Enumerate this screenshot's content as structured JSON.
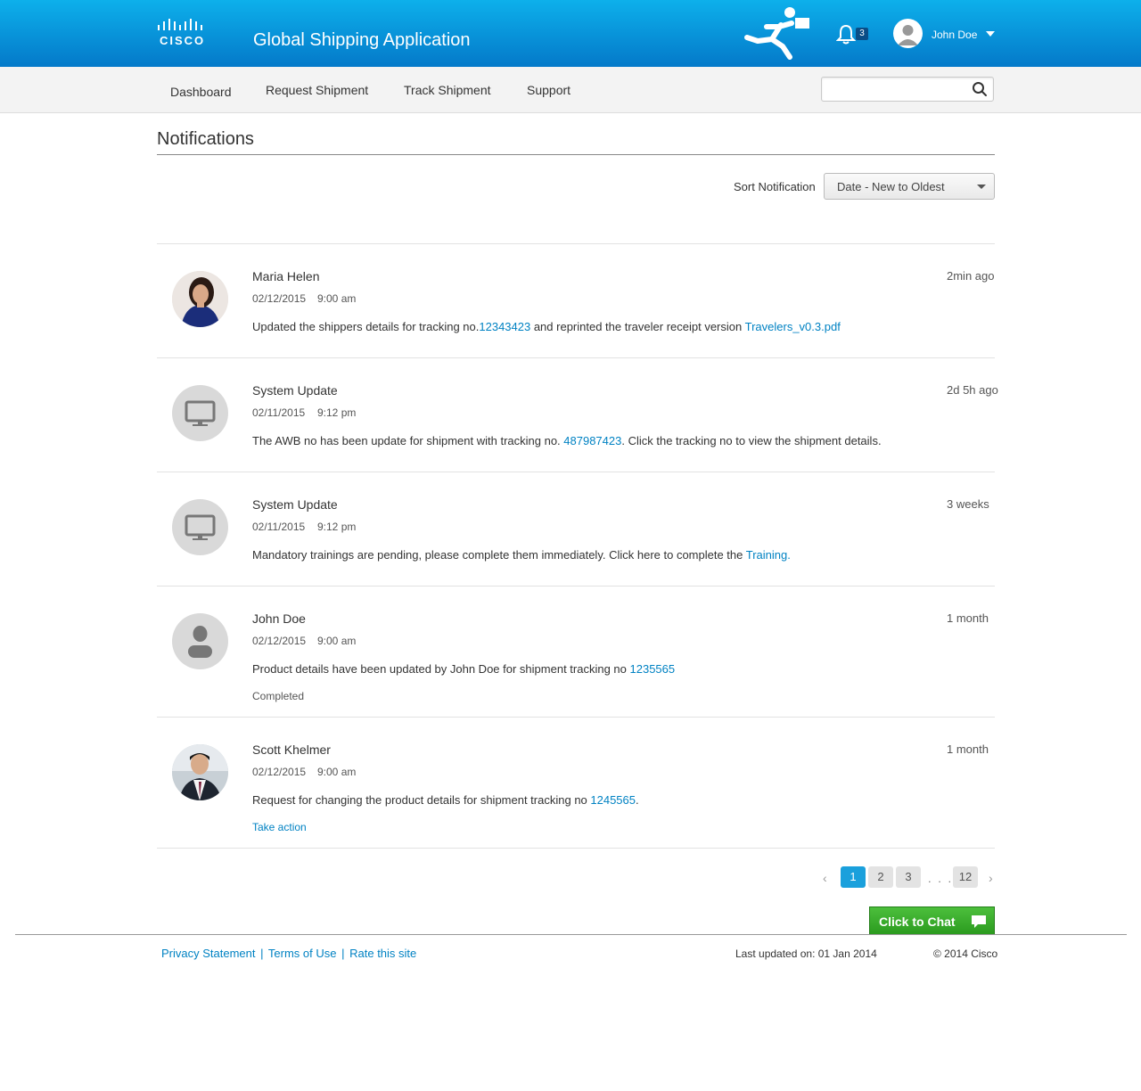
{
  "header": {
    "logo_text": "CISCO",
    "app_title": "Global Shipping Application",
    "notification_count": "3",
    "user_name": "John Doe"
  },
  "nav": {
    "items": [
      "Dashboard",
      "Request Shipment",
      "Track Shipment",
      "Support"
    ],
    "search_placeholder": ""
  },
  "page": {
    "title": "Notifications",
    "sort_label": "Sort Notification",
    "sort_value": "Date - New to Oldest"
  },
  "notifications": [
    {
      "name": "Maria Helen",
      "date": "02/12/2015",
      "time": "9:00 am",
      "ago": "2min ago",
      "msg_before": "Updated the shippers details for tracking no.",
      "link1": "12343423",
      "msg_middle": " and reprinted the traveler receipt version ",
      "link2": "Travelers_v0.3.pdf",
      "msg_after": ""
    },
    {
      "name": "System Update",
      "date": "02/11/2015",
      "time": "9:12 pm",
      "ago": "2d 5h ago",
      "msg_before": "The AWB no has been update for shipment with tracking no. ",
      "link1": "487987423",
      "msg_after": ". Click the tracking no to view the shipment details."
    },
    {
      "name": "System Update",
      "date": "02/11/2015",
      "time": "9:12 pm",
      "ago": "3 weeks",
      "msg_before": "Mandatory trainings are pending, please complete them immediately. Click here to complete the ",
      "link1": "Training.",
      "msg_after": ""
    },
    {
      "name": "John Doe",
      "date": "02/12/2015",
      "time": "9:00 am",
      "ago": "1 month",
      "msg_before": "Product details have been updated by John Doe for shipment tracking no ",
      "link1": "1235565",
      "msg_after": "",
      "status": "Completed"
    },
    {
      "name": "Scott Khelmer",
      "date": "02/12/2015",
      "time": "9:00 am",
      "ago": "1 month",
      "msg_before": "Request for changing the product details for shipment tracking no ",
      "link1": "1245565",
      "msg_after": ".",
      "action": "Take action"
    }
  ],
  "pagination": {
    "pages": [
      "1",
      "2",
      "3",
      "12"
    ],
    "current": "1",
    "ellipsis": ". . ."
  },
  "chat": {
    "label": "Click to Chat"
  },
  "footer": {
    "links": [
      "Privacy Statement",
      "Terms of Use",
      "Rate this site"
    ],
    "separator": "|",
    "last_updated": "Last updated on: 01 Jan 2014",
    "copyright": "© 2014 Cisco"
  },
  "colors": {
    "header_top": "#0db0eb",
    "header_bottom": "#0479c9",
    "link": "#0082c3",
    "page_active": "#1aa0dc",
    "chat_green": "#2a9a1e"
  }
}
